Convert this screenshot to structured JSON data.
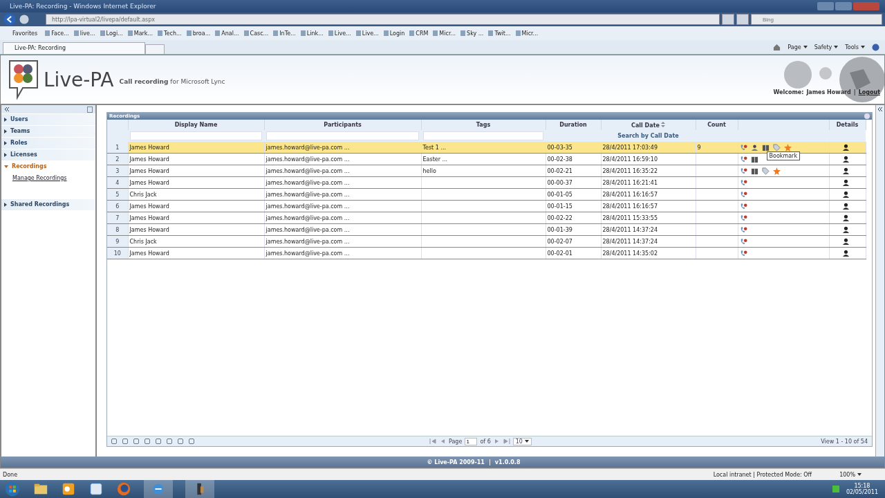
{
  "window": {
    "title": "Live-PA: Recording - Windows Internet Explorer"
  },
  "address_bar": {
    "url": "http://lpa-virtual2/livepa/default.aspx",
    "search_placeholder": "Bing"
  },
  "favorites_bar": {
    "label": "Favorites",
    "items": [
      "Face...",
      "live...",
      "Logi...",
      "Mark...",
      "Tech...",
      "broa...",
      "Anal...",
      "Casc...",
      "InTe...",
      "Link...",
      "Live...",
      "Live...",
      "Login",
      "CRM",
      "Micr...",
      "Sky ...",
      "Twit...",
      "Micr..."
    ]
  },
  "tab": {
    "label": "Live-PA: Recording"
  },
  "command_bar": [
    "Page",
    "Safety",
    "Tools"
  ],
  "header": {
    "logo": "Live-PA",
    "tagline": "**Call recording** for Microsoft Lync",
    "welcome_label": "Welcome:",
    "user": "James Howard",
    "separator": "|",
    "logout": "Logout"
  },
  "sidebar": {
    "items": [
      {
        "label": "Users",
        "expanded": false
      },
      {
        "label": "Teams",
        "expanded": false
      },
      {
        "label": "Roles",
        "expanded": false
      },
      {
        "label": "Licenses",
        "expanded": false
      },
      {
        "label": "Recordings",
        "expanded": true,
        "children": [
          "Manage Recordings"
        ]
      },
      {
        "label": "Shared Recordings",
        "expanded": false
      }
    ]
  },
  "grid": {
    "caption": "Recordings",
    "columns": [
      "Display Name",
      "Participants",
      "Tags",
      "Duration",
      "Call Date",
      "Count",
      "Details"
    ],
    "search_hint": "Search by Call Date",
    "rows": [
      {
        "num": "1",
        "name": "James Howard",
        "participants": "james.howard@live-pa.com ...",
        "tags": "Test 1 ...",
        "duration": "00-03-35",
        "call_date": "28/4/2011 17:03:49",
        "count": "9",
        "selected": true,
        "actions": [
          {
            "kind": "call"
          },
          {
            "kind": "share"
          },
          {
            "kind": "bookmark"
          },
          {
            "kind": "tag"
          },
          {
            "kind": "flag"
          }
        ]
      },
      {
        "num": "2",
        "name": "James Howard",
        "participants": "james.howard@live-pa.com ...",
        "tags": "Easter ...",
        "duration": "00-02-38",
        "call_date": "28/4/2011 16:59:10",
        "count": "",
        "selected": false,
        "actions": [
          {
            "kind": "call"
          },
          {
            "kind": "bookmark"
          }
        ]
      },
      {
        "num": "3",
        "name": "James Howard",
        "participants": "james.howard@live-pa.com ...",
        "tags": "hello",
        "duration": "00-02-21",
        "call_date": "28/4/2011 16:35:22",
        "count": "",
        "selected": false,
        "actions": [
          {
            "kind": "call"
          },
          {
            "kind": "bookmark"
          },
          {
            "kind": "tag"
          },
          {
            "kind": "flag"
          }
        ]
      },
      {
        "num": "4",
        "name": "James Howard",
        "participants": "james.howard@live-pa.com ...",
        "tags": "",
        "duration": "00-00-37",
        "call_date": "28/4/2011 16:21:41",
        "count": "",
        "selected": false,
        "actions": [
          {
            "kind": "call"
          }
        ]
      },
      {
        "num": "5",
        "name": "Chris Jack",
        "participants": "james.howard@live-pa.com ...",
        "tags": "",
        "duration": "00-01-05",
        "call_date": "28/4/2011 16:16:57",
        "count": "",
        "selected": false,
        "actions": [
          {
            "kind": "call"
          }
        ]
      },
      {
        "num": "6",
        "name": "James Howard",
        "participants": "james.howard@live-pa.com ...",
        "tags": "",
        "duration": "00-01-15",
        "call_date": "28/4/2011 16:16:57",
        "count": "",
        "selected": false,
        "actions": [
          {
            "kind": "call"
          }
        ]
      },
      {
        "num": "7",
        "name": "James Howard",
        "participants": "james.howard@live-pa.com ...",
        "tags": "",
        "duration": "00-02-22",
        "call_date": "28/4/2011 15:33:55",
        "count": "",
        "selected": false,
        "actions": [
          {
            "kind": "call"
          }
        ]
      },
      {
        "num": "8",
        "name": "James Howard",
        "participants": "james.howard@live-pa.com ...",
        "tags": "",
        "duration": "00-01-39",
        "call_date": "28/4/2011 14:37:24",
        "count": "",
        "selected": false,
        "actions": [
          {
            "kind": "call"
          }
        ]
      },
      {
        "num": "9",
        "name": "Chris Jack",
        "participants": "james.howard@live-pa.com ...",
        "tags": "",
        "duration": "00-02-07",
        "call_date": "28/4/2011 14:37:24",
        "count": "",
        "selected": false,
        "actions": [
          {
            "kind": "call"
          }
        ]
      },
      {
        "num": "10",
        "name": "James Howard",
        "participants": "james.howard@live-pa.com ...",
        "tags": "",
        "duration": "00-02-01",
        "call_date": "28/4/2011 14:35:02",
        "count": "",
        "selected": false,
        "actions": [
          {
            "kind": "call"
          }
        ]
      }
    ],
    "tooltip": "Bookmark",
    "pager": {
      "page_label": "Page",
      "page": "1",
      "of": "of 6",
      "page_size": "10",
      "summary": "View 1 - 10 of 54"
    }
  },
  "footer": {
    "copyright": "© Live-PA 2009-11",
    "separator": "|",
    "version": "v1.0.0.8"
  },
  "status_bar": {
    "status": "Done",
    "zone": "Local intranet | Protected Mode: Off",
    "zoom": "100%"
  },
  "taskbar": {
    "time": "15:18",
    "date": "02/05/2011"
  }
}
